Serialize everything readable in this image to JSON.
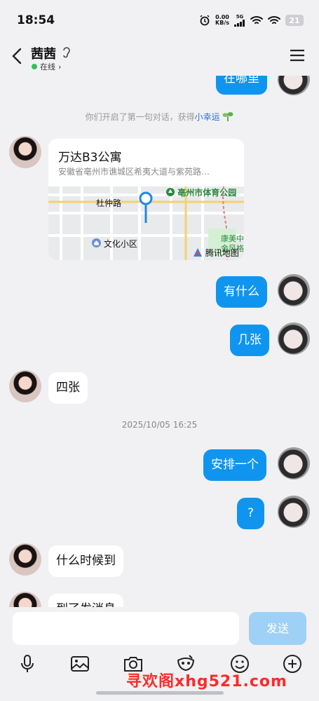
{
  "status": {
    "time": "18:54",
    "net_speed_top": "0.00",
    "net_speed_bottom": "KB/s",
    "signal": "5G",
    "battery": "21"
  },
  "header": {
    "title": "茜茜",
    "online": "在线",
    "online_chevron": "›"
  },
  "messages": {
    "cut_top": "在哪里",
    "system_prefix": "你们开启了第一句对话，获得",
    "system_highlight": "小幸运",
    "location": {
      "title": "万达B3公寓",
      "address": "安徽省亳州市谯城区希夷大道与紫苑路…",
      "map_labels": [
        "杜仲路",
        "亳州市体育公园",
        "康美中",
        "金风格",
        "文化小区",
        "腾讯地图"
      ]
    },
    "m1": "有什么",
    "m2": "几张",
    "m3": "四张",
    "timestamp": "2025/10/05 16:25",
    "m4": "安排一个",
    "m5": "?",
    "m6": "什么时候到",
    "m7_cut": "到了发消息"
  },
  "input": {
    "send": "发送"
  },
  "tools": [
    "microphone-icon",
    "image-icon",
    "camera-icon",
    "mask-icon",
    "emoji-icon",
    "plus-icon"
  ],
  "watermark": "寻欢阁xhg521.com",
  "colors": {
    "accent": "#0f95ef",
    "send_disabled": "#9fd0f5",
    "online": "#2fc25b",
    "highlight": "#2d6fd1"
  }
}
